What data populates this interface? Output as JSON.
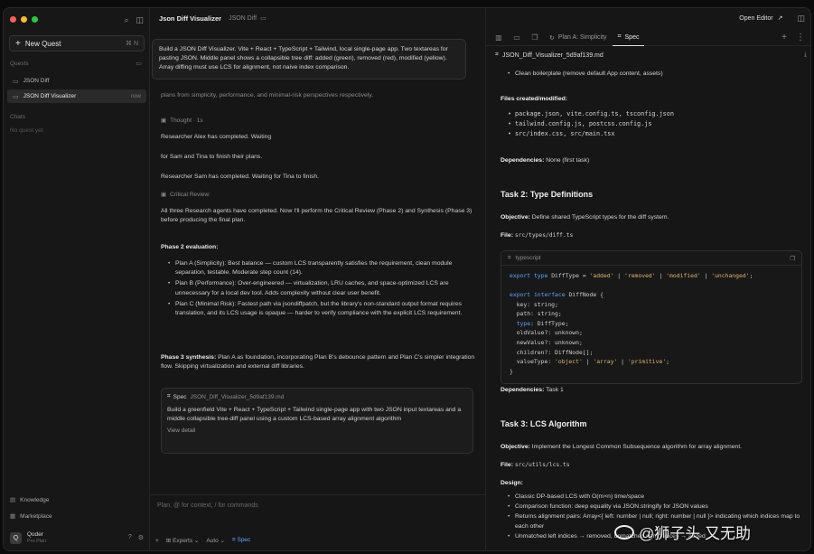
{
  "sidebar": {
    "new_quest": "New Quest",
    "new_quest_kbd": "⌘ N",
    "quests_label": "Quests",
    "items": [
      {
        "label": "JSON Diff",
        "meta": ""
      },
      {
        "label": "JSON Diff Visualizer",
        "meta": "now"
      }
    ],
    "chats_label": "Chats",
    "chats_empty": "No quest yet",
    "knowledge": "Knowledge",
    "marketplace": "Marketplace",
    "user_initial": "Q",
    "user_name": "Qoder",
    "user_plan": "Pro Plan"
  },
  "middle": {
    "title": "Json Diff Visualizer",
    "crumb": "JSON Diff",
    "prompt": "Build a JSON Diff Visualizer. Vite + React + TypeScript + Tailwind, local single-page app. Two textareas for pasting JSON. Middle panel shows a collapsible tree diff: added (green), removed (red), modified (yellow). Array diffing must use LCS for alignment, not naive index comparison.",
    "behind_text": "plans from simplicity, performance, and minimal-risk perspectives respectively.",
    "thought": "Thought · 1s",
    "line1": "Researcher Alex has completed. Waiting",
    "line2": "for Sam and Tina to finish their plans.",
    "line3": "Researcher Sam has completed. Waiting for Tina to finish.",
    "critical": "Critical Review:",
    "line4": "All three Research agents have completed. Now I'll perform the Critical Review (Phase 2) and Synthesis (Phase 3) before producing the final plan.",
    "phase2": "Phase 2 evaluation:",
    "plans": [
      "Plan A (Simplicity): Best balance — custom LCS transparently satisfies the requirement, clean module separation, testable. Moderate step count (14).",
      "Plan B (Performance): Over-engineered — virtualization, LRU caches, and space-optimized LCS are unnecessary for a local dev tool. Adds complexity without clear user benefit.",
      "Plan C (Minimal Risk): Fastest path via jsondiffpatch, but the library's non-standard output format requires translation, and its LCS usage is opaque — harder to verify compliance with the explicit LCS requirement."
    ],
    "phase3_label": "Phase 3 synthesis:",
    "phase3_text": "Plan A as foundation, incorporating Plan B's debounce pattern and Plan C's simpler integration flow. Skipping virtualization and external diff libraries.",
    "spec_card": {
      "tag": "Spec",
      "file": "JSON_Diff_Visualizer_5d9af139.md",
      "body": "Build a greenfield Vite + React + TypeScript + Tailwind single-page app with two JSON input textareas and a middle collapsible tree-diff panel using a custom LCS-based array alignment algorithm",
      "link": "View detail"
    },
    "input_placeholder": "Plan, @ for context, / for commands",
    "mode": "Experts",
    "model": "Auto",
    "spec_toggle": "Spec"
  },
  "right": {
    "open_editor": "Open Editor",
    "tab_plan": "Plan A: Simplicity",
    "tab_spec": "Spec",
    "file": "JSON_Diff_Visualizer_5d9af139.md",
    "bullet_top": "Clean boilerplate (remove default App content, assets)",
    "files_heading": "Files created/modified:",
    "files": [
      "package.json, vite.config.ts, tsconfig.json",
      "tailwind.config.js, postcss.config.js",
      "src/index.css, src/main.tsx"
    ],
    "dep1_label": "Dependencies:",
    "dep1_value": "None (first task)",
    "task2_title": "Task 2: Type Definitions",
    "obj_label": "Objective:",
    "task2_obj": "Define shared TypeScript types for the diff system.",
    "file_label": "File:",
    "task2_file": "src/types/diff.ts",
    "code_lang": "typescript",
    "code_lines": [
      "export type DiffType = 'added' | 'removed' | 'modified' | 'unchanged';",
      "",
      "export interface DiffNode {",
      "  key: string;",
      "  path: string;",
      "  type: DiffType;",
      "  oldValue?: unknown;",
      "  newValue?: unknown;",
      "  children?: DiffNode[];",
      "  valueType: 'object' | 'array' | 'primitive';",
      "}"
    ],
    "dep2_label": "Dependencies:",
    "dep2_value": "Task 1",
    "task3_title": "Task 3: LCS Algorithm",
    "task3_obj": "Implement the Longest Common Subsequence algorithm for array alignment.",
    "task3_file": "src/utils/lcs.ts",
    "design_label": "Design:",
    "design": [
      "Classic DP-based LCS with O(m×n) time/space",
      "Comparison function: deep equality via JSON.stringify for JSON values",
      "Returns alignment pairs: Array<{ left: number | null; right: number | null }> indicating which indices map to each other",
      "Unmatched left indices → removed, unmatched right indices → added"
    ]
  },
  "watermark": "@狮子头 又无助",
  "colors": {
    "accent": "#5aa7ff",
    "send": "#2fbf71",
    "traffic_red": "#fe5f57",
    "traffic_yellow": "#febc2e",
    "traffic_green": "#28c840"
  }
}
